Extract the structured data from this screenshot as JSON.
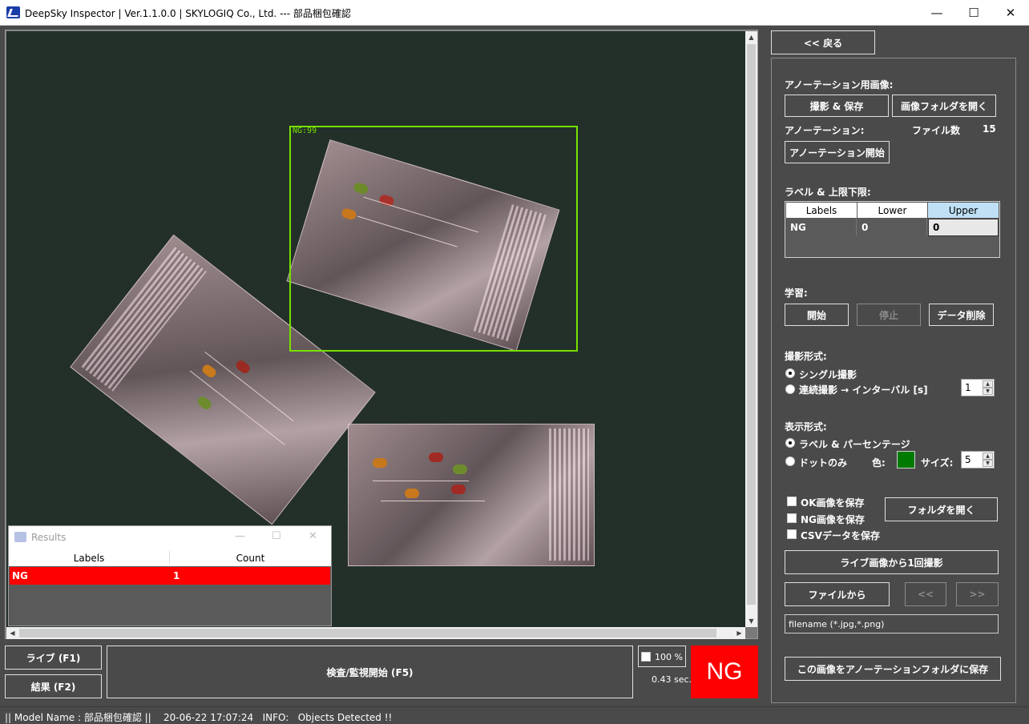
{
  "window": {
    "title": "DeepSky Inspector | Ver.1.1.0.0 | SKYLOGIQ Co., Ltd. --- 部品梱包確認",
    "minimize": "—",
    "maximize": "☐",
    "close": "✕"
  },
  "viewer": {
    "detection_label": "NG:99"
  },
  "results_window": {
    "title": "Results",
    "columns": [
      "Labels",
      "Count"
    ],
    "rows": [
      {
        "label": "NG",
        "count": "1"
      }
    ]
  },
  "bottom": {
    "live_button": "ライブ (F1)",
    "result_button": "結果 (F2)",
    "inspect_button": "検査/監視開始 (F5)",
    "zoom_label": "100 %",
    "elapsed": "0.43 sec.",
    "verdict": "NG"
  },
  "statusbar": {
    "text": "|| Model Name : 部品梱包確認 ||    20-06-22 17:07:24   INFO:   Objects Detected !!"
  },
  "panel": {
    "back_button": "<< 戻る",
    "annotation_image_label": "アノーテーション用画像:",
    "capture_save_button": "撮影 & 保存",
    "open_image_folder_button": "画像フォルダを開く",
    "annotation_label": "アノーテーション:",
    "file_count_label": "ファイル数",
    "file_count": "15",
    "start_annotation_button": "アノーテーション開始",
    "label_limits_title": "ラベル & 上限下限:",
    "grid_headers": [
      "Labels",
      "Lower",
      "Upper"
    ],
    "grid_row": [
      "NG",
      "0",
      "0"
    ],
    "learning_label": "学習:",
    "learn_start": "開始",
    "learn_stop": "停止",
    "delete_data": "データ削除",
    "capture_mode_label": "撮影形式:",
    "single_capture": "シングル撮影",
    "continuous_capture": "連続撮影 → インターバル [s]",
    "interval_value": "1",
    "display_mode_label": "表示形式:",
    "label_percent": "ラベル & パーセンテージ",
    "dot_only": "ドットのみ",
    "color_label": "色:",
    "dot_color": "#007a00",
    "size_label": "サイズ:",
    "size_value": "5",
    "save_ok": "OK画像を保存",
    "save_ng": "NG画像を保存",
    "save_csv": "CSVデータを保存",
    "open_folder_button": "フォルダを開く",
    "capture_from_live": "ライブ画像から1回撮影",
    "from_file": "ファイルから",
    "prev": "<<",
    "next": ">>",
    "filename_placeholder": "filename (*.jpg,*.png)",
    "save_to_annotation": "この画像をアノーテーションフォルダに保存"
  }
}
